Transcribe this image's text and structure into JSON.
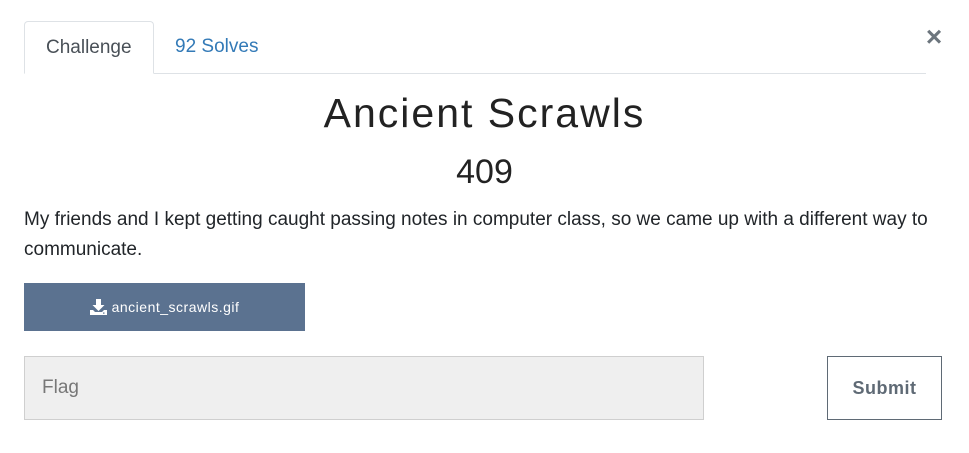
{
  "tabs": [
    {
      "label": "Challenge",
      "active": true
    },
    {
      "label": "92 Solves",
      "active": false
    }
  ],
  "close_label": "×",
  "challenge": {
    "name": "Ancient Scrawls",
    "points": "409",
    "description": "My friends and I kept getting caught passing notes in computer class, so we came up with a different way to communicate."
  },
  "file": {
    "label": "ancient_scrawls.gif",
    "icon": "download-icon"
  },
  "flag": {
    "value": "",
    "placeholder": "Flag"
  },
  "submit_label": "Submit",
  "colors": {
    "link": "#337ab7",
    "file_button": "#5b7290",
    "input_bg": "#efefef"
  }
}
